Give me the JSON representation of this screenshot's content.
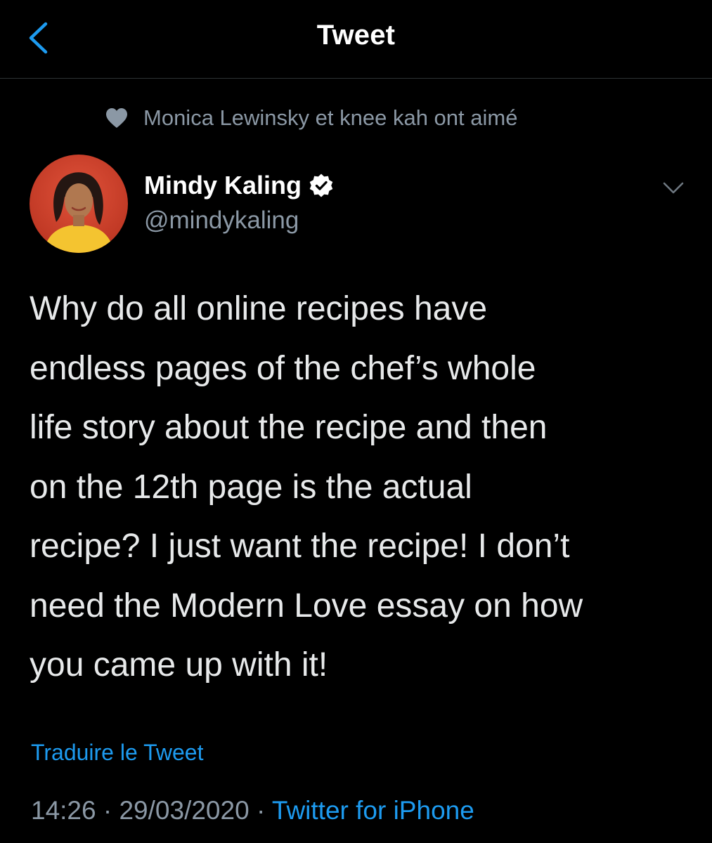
{
  "nav": {
    "title": "Tweet",
    "back_icon": "chevron-left-icon"
  },
  "social_context": {
    "icon": "heart-icon",
    "text": "Monica Lewinsky et knee kah ont aimé"
  },
  "author": {
    "name": "Mindy Kaling",
    "handle": "@mindykaling",
    "verified": true
  },
  "tweet": {
    "text": "Why do all online recipes have\nendless pages of the chef’s whole\nlife story about the recipe and then\non the 12th page is the actual\nrecipe? I just want the recipe! I don’t\nneed the Modern Love essay on how\nyou came up with it!",
    "translate_label": "Traduire le Tweet",
    "time": "14:26",
    "separator": " · ",
    "date": "29/03/2020",
    "source": "Twitter for iPhone"
  },
  "colors": {
    "background": "#000000",
    "accent": "#1d9bf0",
    "secondary_text": "#8b98a5",
    "primary_text": "#e7e9ea"
  }
}
